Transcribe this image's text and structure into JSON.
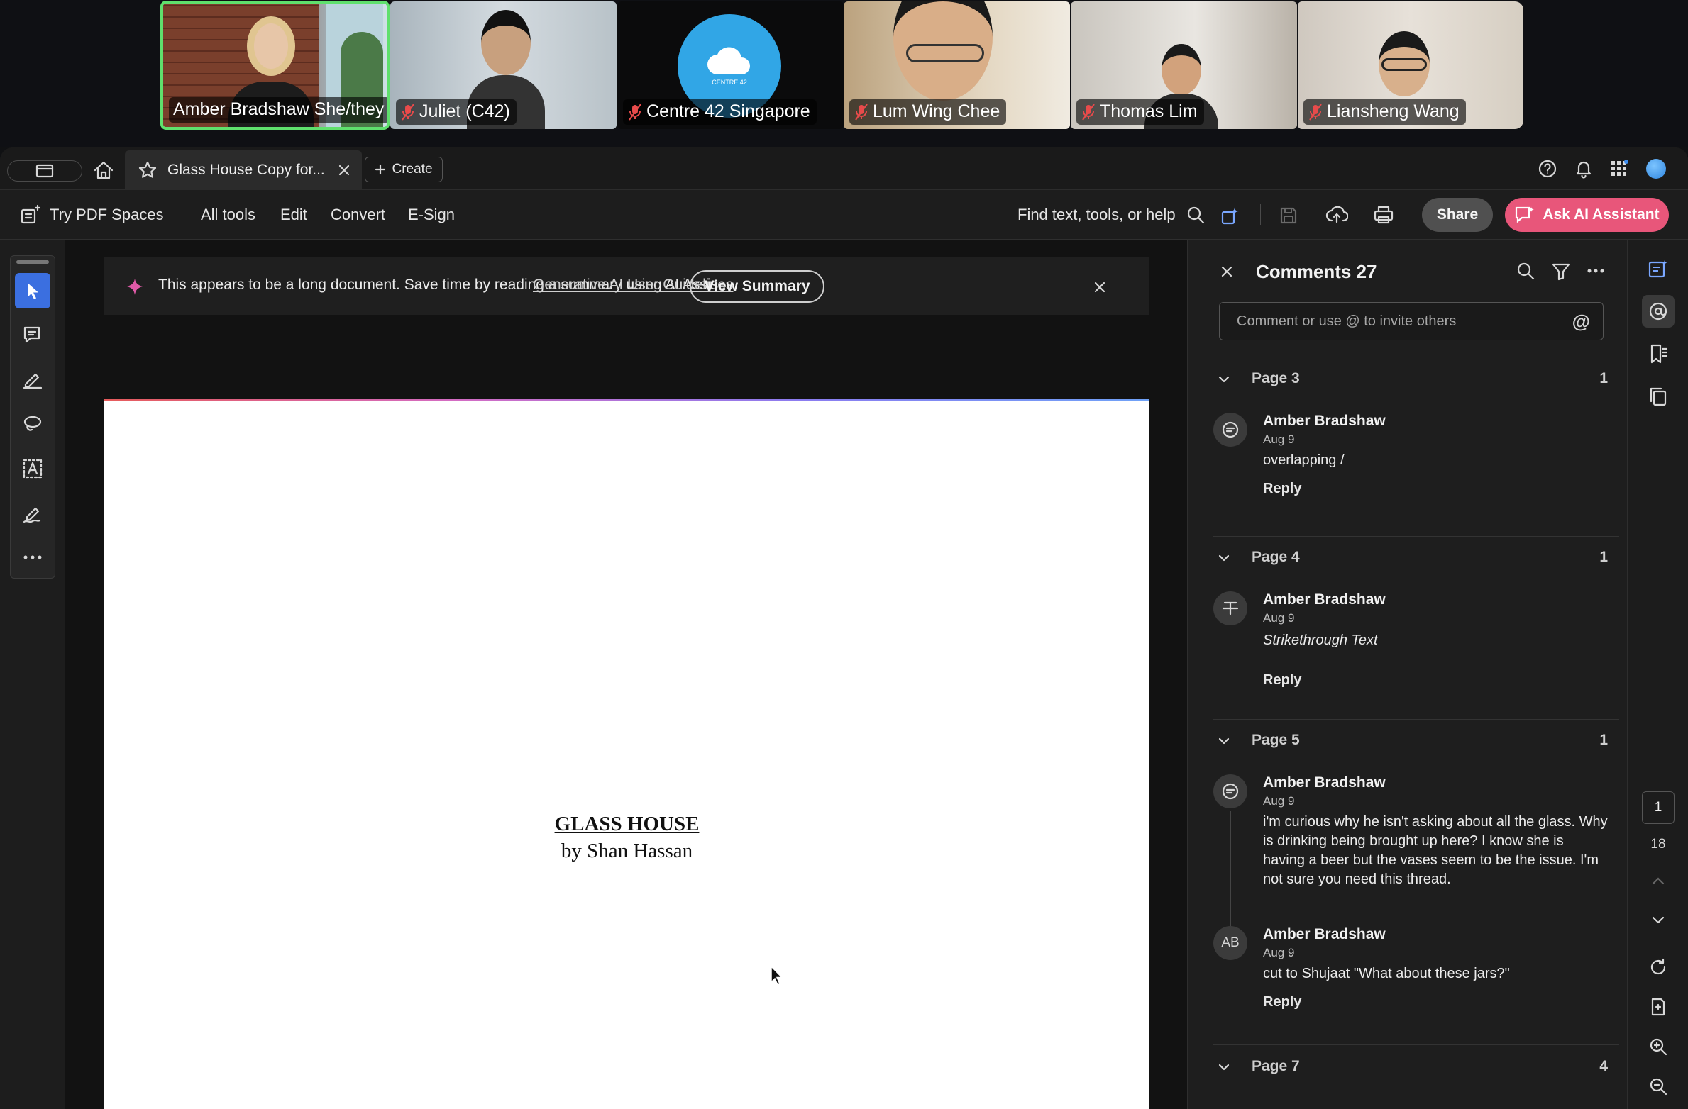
{
  "meeting": {
    "participants": [
      {
        "name": "Amber Bradshaw She/they",
        "muted": false,
        "active": true
      },
      {
        "name": "Juliet (C42)",
        "muted": true,
        "active": false
      },
      {
        "name": "Centre 42 Singapore",
        "muted": true,
        "active": false
      },
      {
        "name": "Lum Wing Chee",
        "muted": true,
        "active": false
      },
      {
        "name": "Thomas Lim",
        "muted": true,
        "active": false
      },
      {
        "name": "Liansheng Wang",
        "muted": true,
        "active": false
      }
    ],
    "org_logo_text": "CENTRE 42"
  },
  "tabs": {
    "document_tab": "Glass House Copy for...",
    "create_label": "Create"
  },
  "toolbar": {
    "try_spaces": "Try PDF Spaces",
    "all_tools": "All tools",
    "edit": "Edit",
    "convert": "Convert",
    "esign": "E-Sign",
    "find": "Find text, tools, or help",
    "share": "Share",
    "ask_ai": "Ask AI Assistant"
  },
  "banner": {
    "message": "This appears to be a long document. Save time by reading a summary using AI Assis...",
    "link": "Generative AI User Guidelines",
    "button": "View Summary"
  },
  "document": {
    "title": "GLASS HOUSE",
    "byline": "by Shan Hassan"
  },
  "comments_panel": {
    "title": "Comments 27",
    "input_placeholder": "Comment or use @ to invite others",
    "reply_label": "Reply",
    "pages": [
      {
        "label": "Page 3",
        "count": "1"
      },
      {
        "label": "Page 4",
        "count": "1"
      },
      {
        "label": "Page 5",
        "count": "1"
      },
      {
        "label": "Page 7",
        "count": "4"
      }
    ],
    "comments": [
      {
        "author": "Amber Bradshaw",
        "date": "Aug 9",
        "text": "overlapping /"
      },
      {
        "author": "Amber Bradshaw",
        "date": "Aug 9",
        "text": "Strikethrough Text"
      },
      {
        "author": "Amber Bradshaw",
        "date": "Aug 9",
        "text": "i'm curious why he isn't asking about all the glass. Why is drinking being brought up here? I know she is having a beer but the vases seem to be the issue. I'm not sure you need this thread."
      },
      {
        "author": "Amber Bradshaw",
        "date": "Aug 9",
        "initials": "AB",
        "text": "cut to Shujaat \"What about these jars?\""
      }
    ]
  },
  "pager": {
    "current": "1",
    "total": "18"
  },
  "colors": {
    "accent_blue": "#3b6fe0",
    "ai_button": "#e8567a",
    "speaker_border": "#5fe06d",
    "muted_mic": "#e84b4b"
  }
}
